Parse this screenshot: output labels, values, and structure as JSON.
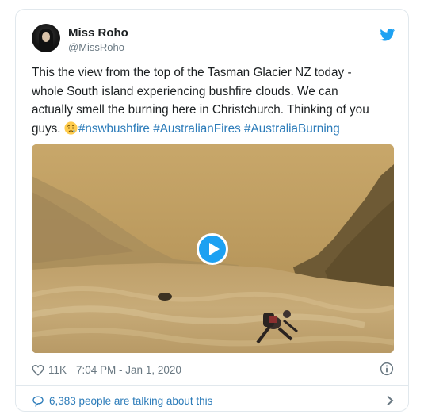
{
  "author": {
    "display_name": "Miss Roho",
    "handle": "@MissRoho"
  },
  "tweet": {
    "lines": [
      "This the view from the top of the Tasman Glacier NZ today -",
      "whole South island experiencing bushfire clouds. We can",
      "actually smell the burning here in Christchurch. Thinking of you"
    ],
    "last_line_prefix": "guys. ",
    "emoji": "crying-face",
    "hashtags": [
      "#nswbushfire",
      "#AustralianFires",
      "#AustraliaBurning"
    ]
  },
  "media": {
    "type": "video",
    "play_icon": "play-icon"
  },
  "stats": {
    "likes": "11K",
    "timestamp": "7:04 PM - Jan 1, 2020"
  },
  "conversation": {
    "label": "6,383 people are talking about this"
  },
  "icons": {
    "brand": "twitter-bird-icon",
    "like": "heart-icon",
    "info": "info-icon",
    "conversation": "speech-bubble-icon",
    "more": "chevron-right-icon"
  },
  "colors": {
    "link": "#2b7bb9",
    "brand": "#1da1f2",
    "muted": "#697882",
    "border": "#e1e8ed"
  }
}
